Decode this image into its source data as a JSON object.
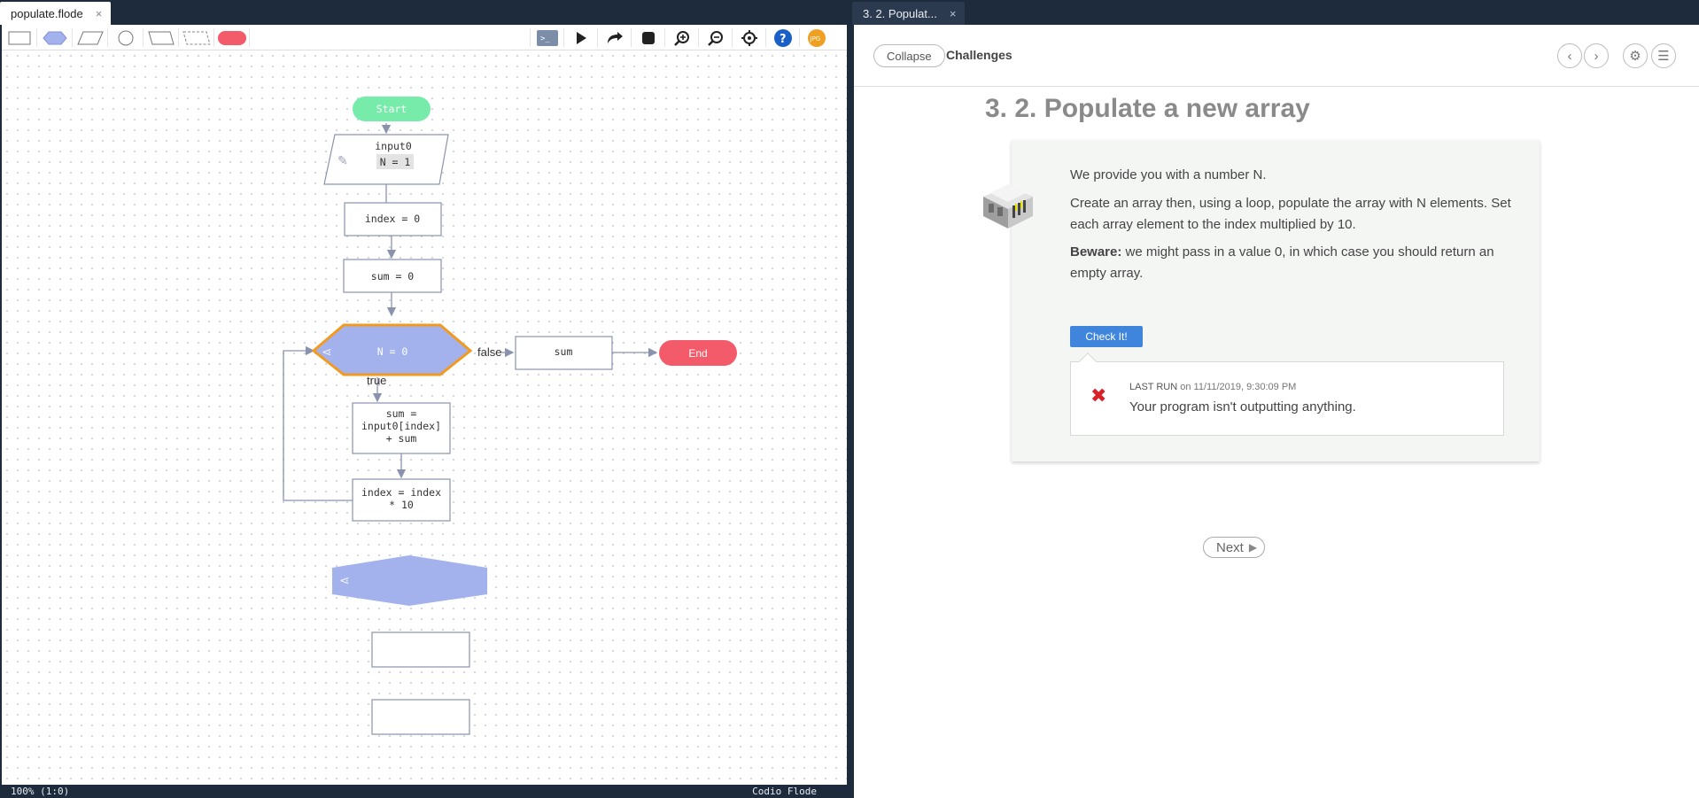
{
  "left_tab": {
    "label": "populate.flode",
    "close": "×"
  },
  "right_tab": {
    "label": "3. 2. Populat...",
    "close": "×"
  },
  "flowchart": {
    "start": "Start",
    "input_title": "input0",
    "input_value": "N = 1",
    "step_index_init": "index = 0",
    "step_sum_init": "sum = 0",
    "decision": "N = 0",
    "false_label": "false",
    "true_label": "true",
    "output": "sum",
    "end": "End",
    "loop_body_1": [
      "sum =",
      "input0[index]",
      "+ sum"
    ],
    "loop_body_2": [
      "index = index",
      "* 10"
    ]
  },
  "toolbar": {
    "export_label": "JPG"
  },
  "statusbar": {
    "zoom": "100% (1:0)",
    "app": "Codio Flode"
  },
  "guide": {
    "collapse": "Collapse",
    "section": "Challenges",
    "title": "3. 2. Populate a new array",
    "p1": "We provide you with a number N.",
    "p2": "Create an array then, using a loop, populate the array with N elements. Set each array element to the index multiplied by 10.",
    "p3_bold": "Beware:",
    "p3": " we might pass in a value 0, in which case you should return an empty array.",
    "check_button": "Check It!",
    "last_run_label": "LAST RUN",
    "last_run_time": "on 11/11/2019, 9:30:09 PM",
    "run_message": "Your program isn't outputting anything.",
    "next": "Next"
  },
  "colors": {
    "decision_fill": "#a3b2ec",
    "decision_stroke": "#f29a1f",
    "start_fill": "#76ebaa",
    "end_fill": "#f45b6a",
    "check_blue": "#3e85db",
    "error_red": "#d9212a"
  }
}
